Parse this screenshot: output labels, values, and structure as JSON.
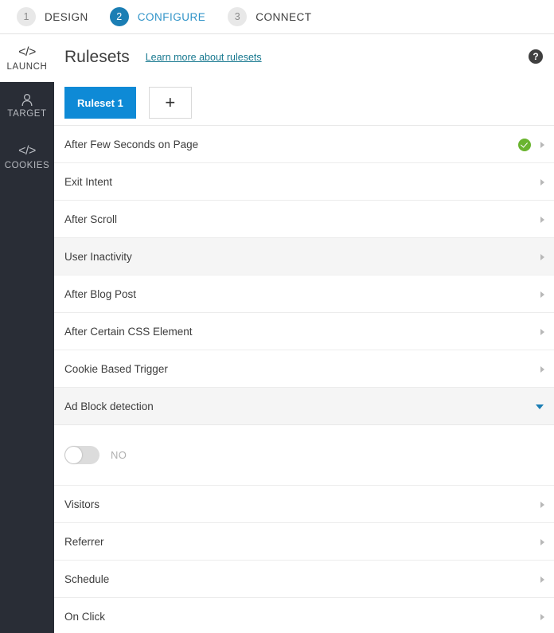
{
  "steps": [
    {
      "num": "1",
      "label": "DESIGN",
      "active": false
    },
    {
      "num": "2",
      "label": "CONFIGURE",
      "active": true
    },
    {
      "num": "3",
      "label": "CONNECT",
      "active": false
    }
  ],
  "sidebar": {
    "items": [
      {
        "icon": "code-icon",
        "glyph": "</>",
        "label": "LAUNCH",
        "active": true
      },
      {
        "icon": "user-icon",
        "glyph": "person",
        "label": "TARGET",
        "active": false
      },
      {
        "icon": "code-icon",
        "glyph": "</>",
        "label": "COOKIES",
        "active": false
      }
    ]
  },
  "header": {
    "title": "Rulesets",
    "learn_more_link": "Learn more about rulesets",
    "help_glyph": "?"
  },
  "tabs": {
    "ruleset_label": "Ruleset 1",
    "add_label": "+"
  },
  "rules": [
    {
      "label": "After Few Seconds on Page",
      "state": "enabled",
      "expanded": false,
      "highlight": false
    },
    {
      "label": "Exit Intent",
      "state": "default",
      "expanded": false,
      "highlight": false
    },
    {
      "label": "After Scroll",
      "state": "default",
      "expanded": false,
      "highlight": false
    },
    {
      "label": "User Inactivity",
      "state": "default",
      "expanded": false,
      "highlight": true
    },
    {
      "label": "After Blog Post",
      "state": "default",
      "expanded": false,
      "highlight": false
    },
    {
      "label": "After Certain CSS Element",
      "state": "default",
      "expanded": false,
      "highlight": false
    },
    {
      "label": "Cookie Based Trigger",
      "state": "default",
      "expanded": false,
      "highlight": false
    },
    {
      "label": "Ad Block detection",
      "state": "default",
      "expanded": true,
      "highlight": false
    },
    {
      "label": "Visitors",
      "state": "default",
      "expanded": false,
      "highlight": false
    },
    {
      "label": "Referrer",
      "state": "default",
      "expanded": false,
      "highlight": false
    },
    {
      "label": "Schedule",
      "state": "default",
      "expanded": false,
      "highlight": false
    },
    {
      "label": "On Click",
      "state": "default",
      "expanded": false,
      "highlight": false
    }
  ],
  "ad_block_panel": {
    "toggle_value": "NO",
    "toggle_on": false
  },
  "colors": {
    "accent_blue": "#1b7eb4",
    "tab_blue": "#0e8ad6",
    "link_teal": "#17788f",
    "success_green": "#6ab42f",
    "sidebar_dark": "#292d36"
  }
}
